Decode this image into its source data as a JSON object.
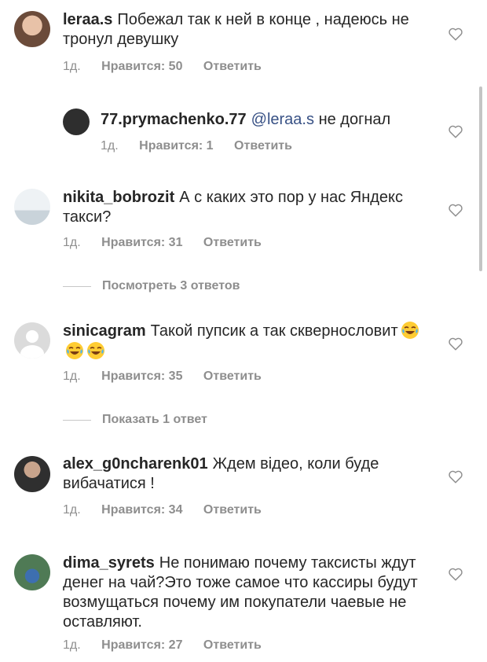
{
  "comments": [
    {
      "username": "leraa.s",
      "text": "Побежал так к ней в конце , надеюсь не тронул девушку",
      "time": "1д.",
      "likes": "Нравится: 50",
      "reply": "Ответить",
      "avatar_color": "#c9a38a"
    },
    {
      "username": "77.prymachenko.77",
      "mention": "@leraa.s",
      "text": "не догнал",
      "time": "1д.",
      "likes": "Нравится: 1",
      "reply": "Ответить",
      "avatar_color": "#3a3a3a"
    },
    {
      "username": "nikita_bobrozit",
      "text": "А с каких это пор у нас Яндекс такси?",
      "time": "1д.",
      "likes": "Нравится: 31",
      "reply": "Ответить",
      "avatar_color": "#dfe5ea"
    },
    {
      "username": "sinicagram",
      "text": "Такой пупсик а так сквернословит",
      "emoji_count": 3,
      "time": "1д.",
      "likes": "Нравится: 35",
      "reply": "Ответить",
      "avatar_color": "#dbdbdb"
    },
    {
      "username": "alex_g0ncharenk01",
      "text": "Ждем відео, коли буде вибачатися !",
      "time": "1д.",
      "likes": "Нравится: 34",
      "reply": "Ответить",
      "avatar_color": "#6b6b6b"
    },
    {
      "username": "dima_syrets",
      "text": "Не понимаю почему таксисты ждут денег на чай?Это тоже самое что кассиры будут возмущаться почему им покупатели чаевые не оставляют.",
      "time": "1д.",
      "likes": "Нравится: 27",
      "reply": "Ответить",
      "avatar_color": "#4f7a55"
    }
  ],
  "view_replies": [
    "Посмотреть 3 ответов",
    "Показать 1 ответ"
  ],
  "icons": {
    "like": "heart-outline-icon",
    "emoji": "face-with-tears-of-joy-icon"
  }
}
